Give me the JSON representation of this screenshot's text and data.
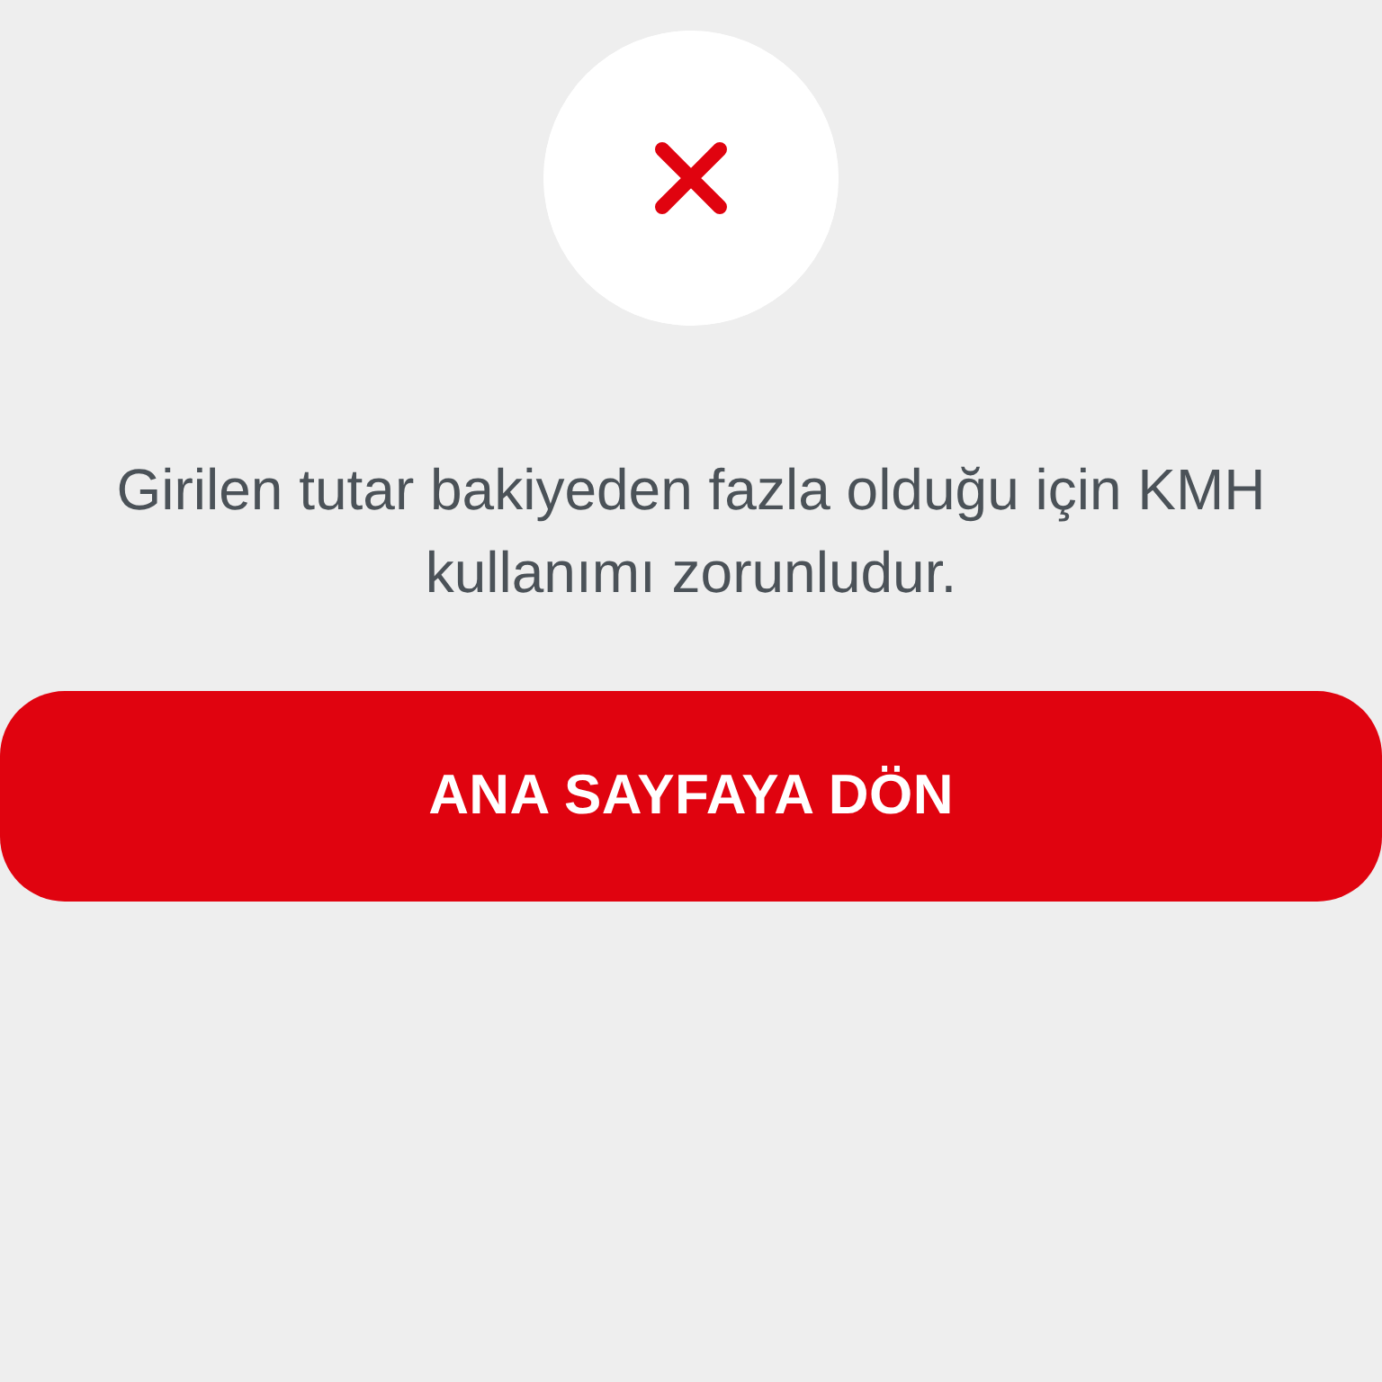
{
  "message": "Girilen tutar bakiyeden fazla olduğu için KMH kullanımı zorunludur.",
  "primary_button": {
    "label": "ANA SAYFAYA DÖN"
  }
}
